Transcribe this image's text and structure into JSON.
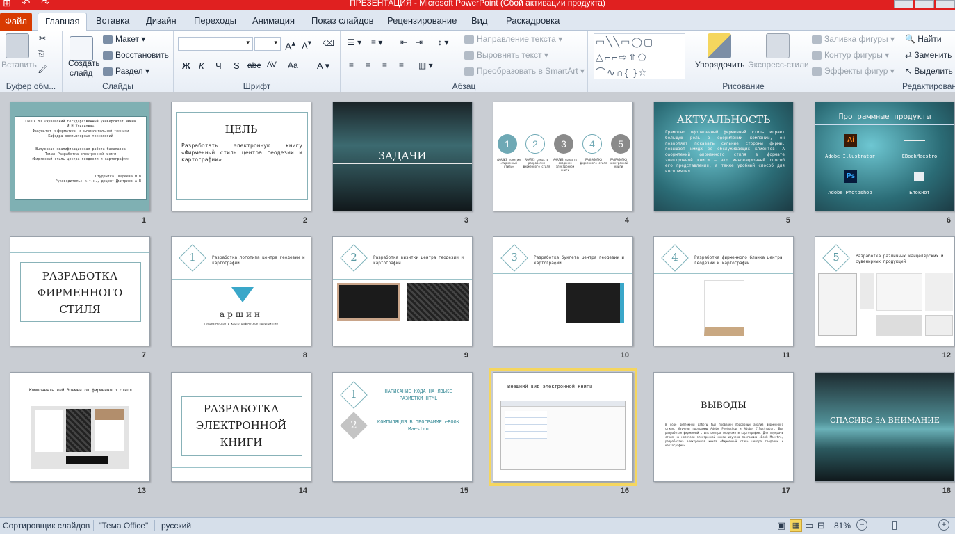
{
  "window": {
    "title": "ПРЕЗЕНТАЦИЯ  -  Microsoft PowerPoint (Сбой активации продукта)"
  },
  "tabs": {
    "file": "Файл",
    "items": [
      "Главная",
      "Вставка",
      "Дизайн",
      "Переходы",
      "Анимация",
      "Показ слайдов",
      "Рецензирование",
      "Вид",
      "Раскадровка"
    ]
  },
  "ribbon": {
    "clipboard": {
      "paste": "Вставить",
      "label": "Буфер обм..."
    },
    "slides": {
      "new_slide_1": "Создать",
      "new_slide_2": "слайд",
      "layout": "Макет",
      "reset": "Восстановить",
      "section": "Раздел",
      "label": "Слайды"
    },
    "font": {
      "label": "Шрифт",
      "bold": "Ж",
      "italic": "К",
      "underline": "Ч",
      "shadow": "S",
      "strike": "abc",
      "spacing": "AV",
      "case": "Aa"
    },
    "paragraph": {
      "text_direction": "Направление текста",
      "align_text": "Выровнять текст",
      "smartart": "Преобразовать в SmartArt",
      "label": "Абзац"
    },
    "drawing": {
      "arrange": "Упорядочить",
      "quick_styles": "Экспресс-стили",
      "fill": "Заливка фигуры",
      "outline": "Контур фигуры",
      "effects": "Эффекты фигур",
      "label": "Рисование"
    },
    "editing": {
      "find": "Найти",
      "replace": "Заменить",
      "select": "Выделить",
      "label": "Редактирован"
    }
  },
  "slides": [
    {
      "num": "1",
      "lines": [
        "ГБПОУ ВО «Чувашский государственный университет имени",
        "И.Н.Ульянова»",
        "Факультет информатики и вычислительной техники",
        "Кафедра компьютерных технологий",
        "Выпускная квалификационная работа бакалавра",
        "Тема: Разработка электронной книги",
        "«Фирменный стиль центра геодезии и картографии»",
        "Студентка: Фадеева Н.В.",
        "Руководитель: к.т.н., доцент Дмитриев А.В."
      ]
    },
    {
      "num": "2",
      "title": "ЦЕЛЬ",
      "body": "Разработать электронную книгу «Фирменный стиль центра геодезии и картографии»"
    },
    {
      "num": "3",
      "title": "ЗАДАЧИ"
    },
    {
      "num": "4",
      "steps": [
        "1",
        "2",
        "3",
        "4",
        "5"
      ],
      "captions": [
        "АНАЛИЗ понятия «Фирменный стиль»",
        "АНАЛИЗ средств разработки фирменного стиля",
        "АНАЛИЗ средств создания электронной книги",
        "РАЗРАБОТКА фирменного стиля",
        "РАЗРАБОТКА электронной книги"
      ]
    },
    {
      "num": "5",
      "title": "АКТУАЛЬНОСТЬ",
      "body": "Грамотно оформленный фирменный стиль играет большую роль в оформлении компании, он позволяет показать сильные стороны фирмы, повышает имидж ее обслуживающих клиентов. А оформлений фирменного стиля в формате электронной книги – это инновационный способ его представления, а также удобный способ для восприятия."
    },
    {
      "num": "6",
      "title": "Программные продукты",
      "items": [
        "Adobe Illustrator",
        "EBookMaestro",
        "Adobe Photoshop",
        "Блокнот"
      ],
      "icon_ai": "Ai",
      "icon_ps": "Ps"
    },
    {
      "num": "7",
      "title": "РАЗРАБОТКА ФИРМЕННОГО СТИЛЯ"
    },
    {
      "num": "8",
      "step": "1",
      "title": "Разработка логотипа центра геодезии и картографии",
      "logo": "аршин",
      "logo_sub": "геодезическое и картографическое предприятие"
    },
    {
      "num": "9",
      "step": "2",
      "title": "Разработка визитки центра геодезии и картографии"
    },
    {
      "num": "10",
      "step": "3",
      "title": "Разработка буклета центра геодезии и картографии"
    },
    {
      "num": "11",
      "step": "4",
      "title": "Разработка фирменного бланка центра геодезии и картографии"
    },
    {
      "num": "12",
      "step": "5",
      "title": "Разработка различных канцелярских и сувенирных продукций"
    },
    {
      "num": "13",
      "title": "Компоненты вей Элементов фирменного стиля"
    },
    {
      "num": "14",
      "title": "РАЗРАБОТКА ЭЛЕКТРОННОЙ КНИГИ"
    },
    {
      "num": "15",
      "steps": [
        "1",
        "2"
      ],
      "items": [
        "НАПИСАНИЕ КОДА НА ЯЗЫКЕ РАЗМЕТКИ HTML",
        "КОМПИЛЯЦИЯ В ПРОГРАММЕ eBOOK Maestro"
      ]
    },
    {
      "num": "16",
      "title": "Внешний вид электронной книги"
    },
    {
      "num": "17",
      "title": "ВЫВОДЫ",
      "body": "В ходе дипломной работы был проведен подробный анализ фирменного стиля. Изучены программы Adobe Photoshop и Adobe Illustrator. Был разработан фирменный стиль центра геодезии и картографии. Для передачи стиля на носители электронной книги изучена программа eBook Maestro, разработана электронная книга «Фирменный стиль центра геодезии и картографии»."
    },
    {
      "num": "18",
      "title": "СПАСИБО ЗА ВНИМАНИЕ"
    }
  ],
  "status": {
    "view": "Сортировщик слайдов",
    "theme": "\"Тема Office\"",
    "language": "русский",
    "zoom": "81%"
  }
}
